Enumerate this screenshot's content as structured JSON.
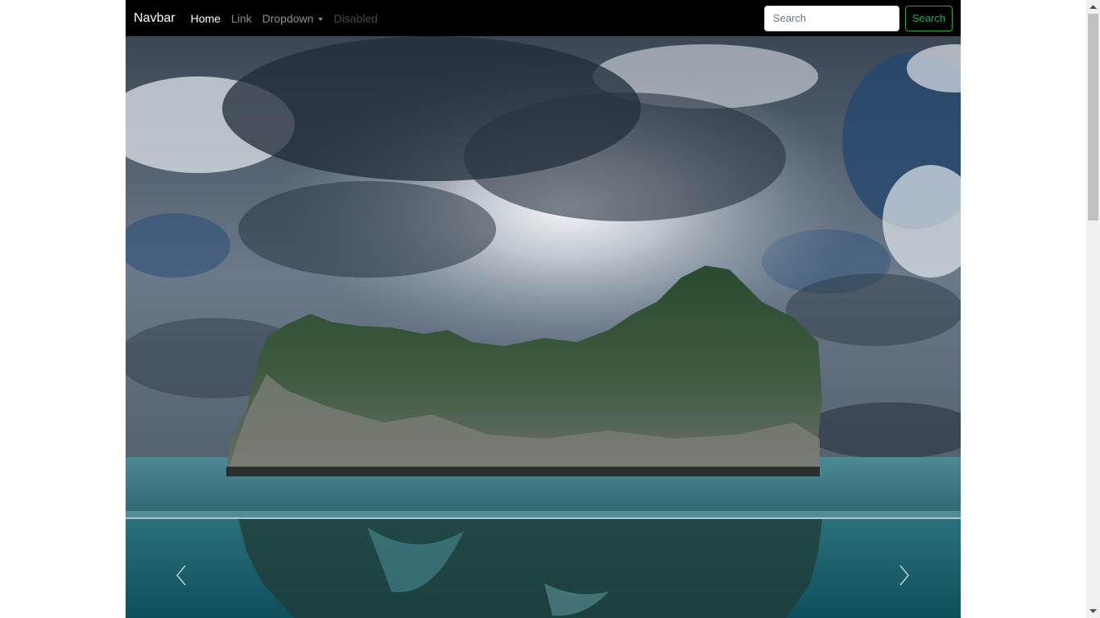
{
  "navbar": {
    "brand": "Navbar",
    "links": [
      {
        "label": "Home",
        "state": "active"
      },
      {
        "label": "Link",
        "state": "normal"
      },
      {
        "label": "Dropdown",
        "state": "dropdown"
      },
      {
        "label": "Disabled",
        "state": "disabled"
      }
    ],
    "search": {
      "placeholder": "Search",
      "value": "",
      "button_label": "Search"
    },
    "colors": {
      "background": "#000000",
      "search_button": "#28a745"
    }
  },
  "carousel": {
    "image": "rocky-island-in-sea-under-stormy-sky",
    "prev_icon": "chevron-left-icon",
    "next_icon": "chevron-right-icon"
  },
  "scrollbar": {
    "up_icon": "scroll-up-arrow-icon",
    "down_icon": "scroll-down-arrow-icon"
  }
}
